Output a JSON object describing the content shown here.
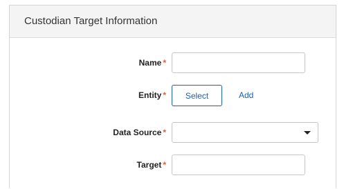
{
  "panel": {
    "title": "Custodian Target Information"
  },
  "form": {
    "required_marker": "*",
    "name": {
      "label": "Name",
      "value": ""
    },
    "entity": {
      "label": "Entity",
      "select_button": "Select",
      "add_link": "Add"
    },
    "data_source": {
      "label": "Data Source",
      "selected_value": ""
    },
    "target": {
      "label": "Target",
      "value": ""
    }
  },
  "colors": {
    "required": "#e2593a",
    "accent": "#1a5fb4",
    "header_bg": "#f4f4f4"
  }
}
